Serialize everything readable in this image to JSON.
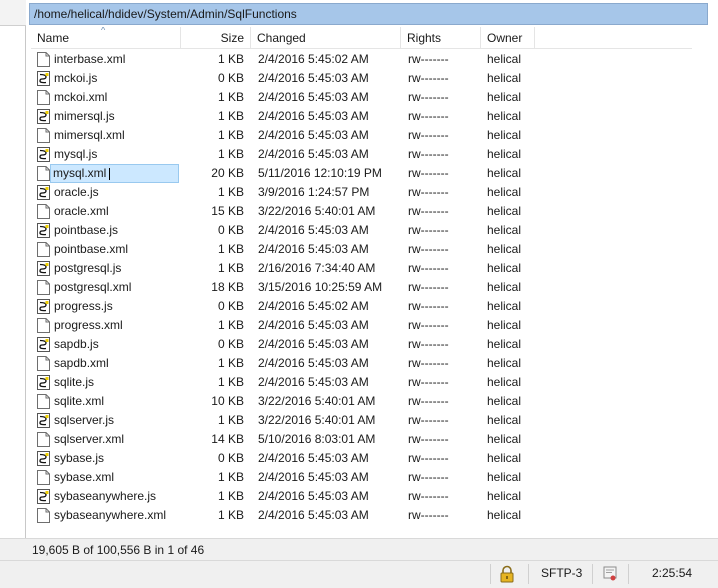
{
  "path": "/home/helical/hdidev/System/Admin/SqlFunctions",
  "columns": {
    "name": "Name",
    "size": "Size",
    "changed": "Changed",
    "rights": "Rights",
    "owner": "Owner"
  },
  "files": [
    {
      "name": "interbase.xml",
      "size": "1 KB",
      "changed": "2/4/2016 5:45:02 AM",
      "rights": "rw-------",
      "owner": "helical",
      "icon": "xml-file-icon"
    },
    {
      "name": "mckoi.js",
      "size": "0 KB",
      "changed": "2/4/2016 5:45:03 AM",
      "rights": "rw-------",
      "owner": "helical",
      "icon": "js-file-icon"
    },
    {
      "name": "mckoi.xml",
      "size": "1 KB",
      "changed": "2/4/2016 5:45:03 AM",
      "rights": "rw-------",
      "owner": "helical",
      "icon": "xml-file-icon"
    },
    {
      "name": "mimersql.js",
      "size": "1 KB",
      "changed": "2/4/2016 5:45:03 AM",
      "rights": "rw-------",
      "owner": "helical",
      "icon": "js-file-icon"
    },
    {
      "name": "mimersql.xml",
      "size": "1 KB",
      "changed": "2/4/2016 5:45:03 AM",
      "rights": "rw-------",
      "owner": "helical",
      "icon": "xml-file-icon"
    },
    {
      "name": "mysql.js",
      "size": "1 KB",
      "changed": "2/4/2016 5:45:03 AM",
      "rights": "rw-------",
      "owner": "helical",
      "icon": "js-file-icon"
    },
    {
      "name": "mysql.xml",
      "size": "20 KB",
      "changed": "5/11/2016 12:10:19 PM",
      "rights": "rw-------",
      "owner": "helical",
      "icon": "xml-file-icon",
      "selected": true
    },
    {
      "name": "oracle.js",
      "size": "1 KB",
      "changed": "3/9/2016 1:24:57 PM",
      "rights": "rw-------",
      "owner": "helical",
      "icon": "js-file-icon"
    },
    {
      "name": "oracle.xml",
      "size": "15 KB",
      "changed": "3/22/2016 5:40:01 AM",
      "rights": "rw-------",
      "owner": "helical",
      "icon": "xml-file-icon"
    },
    {
      "name": "pointbase.js",
      "size": "0 KB",
      "changed": "2/4/2016 5:45:03 AM",
      "rights": "rw-------",
      "owner": "helical",
      "icon": "js-file-icon"
    },
    {
      "name": "pointbase.xml",
      "size": "1 KB",
      "changed": "2/4/2016 5:45:03 AM",
      "rights": "rw-------",
      "owner": "helical",
      "icon": "xml-file-icon"
    },
    {
      "name": "postgresql.js",
      "size": "1 KB",
      "changed": "2/16/2016 7:34:40 AM",
      "rights": "rw-------",
      "owner": "helical",
      "icon": "js-file-icon"
    },
    {
      "name": "postgresql.xml",
      "size": "18 KB",
      "changed": "3/15/2016 10:25:59 AM",
      "rights": "rw-------",
      "owner": "helical",
      "icon": "xml-file-icon"
    },
    {
      "name": "progress.js",
      "size": "0 KB",
      "changed": "2/4/2016 5:45:02 AM",
      "rights": "rw-------",
      "owner": "helical",
      "icon": "js-file-icon"
    },
    {
      "name": "progress.xml",
      "size": "1 KB",
      "changed": "2/4/2016 5:45:03 AM",
      "rights": "rw-------",
      "owner": "helical",
      "icon": "xml-file-icon"
    },
    {
      "name": "sapdb.js",
      "size": "0 KB",
      "changed": "2/4/2016 5:45:03 AM",
      "rights": "rw-------",
      "owner": "helical",
      "icon": "js-file-icon"
    },
    {
      "name": "sapdb.xml",
      "size": "1 KB",
      "changed": "2/4/2016 5:45:03 AM",
      "rights": "rw-------",
      "owner": "helical",
      "icon": "xml-file-icon"
    },
    {
      "name": "sqlite.js",
      "size": "1 KB",
      "changed": "2/4/2016 5:45:03 AM",
      "rights": "rw-------",
      "owner": "helical",
      "icon": "js-file-icon"
    },
    {
      "name": "sqlite.xml",
      "size": "10 KB",
      "changed": "3/22/2016 5:40:01 AM",
      "rights": "rw-------",
      "owner": "helical",
      "icon": "xml-file-icon"
    },
    {
      "name": "sqlserver.js",
      "size": "1 KB",
      "changed": "3/22/2016 5:40:01 AM",
      "rights": "rw-------",
      "owner": "helical",
      "icon": "js-file-icon"
    },
    {
      "name": "sqlserver.xml",
      "size": "14 KB",
      "changed": "5/10/2016 8:03:01 AM",
      "rights": "rw-------",
      "owner": "helical",
      "icon": "xml-file-icon"
    },
    {
      "name": "sybase.js",
      "size": "0 KB",
      "changed": "2/4/2016 5:45:03 AM",
      "rights": "rw-------",
      "owner": "helical",
      "icon": "js-file-icon"
    },
    {
      "name": "sybase.xml",
      "size": "1 KB",
      "changed": "2/4/2016 5:45:03 AM",
      "rights": "rw-------",
      "owner": "helical",
      "icon": "xml-file-icon"
    },
    {
      "name": "sybaseanywhere.js",
      "size": "1 KB",
      "changed": "2/4/2016 5:45:03 AM",
      "rights": "rw-------",
      "owner": "helical",
      "icon": "js-file-icon"
    },
    {
      "name": "sybaseanywhere.xml",
      "size": "1 KB",
      "changed": "2/4/2016 5:45:03 AM",
      "rights": "rw-------",
      "owner": "helical",
      "icon": "xml-file-icon"
    }
  ],
  "status": {
    "selection_info": "19,605 B of 100,556 B in 1 of 46"
  },
  "statusbar": {
    "lock_icon": "lock-icon",
    "protocol": "SFTP-3",
    "cert_icon": "certificate-icon",
    "elapsed": "2:25:54"
  },
  "colors": {
    "path_bar": "#a6c6e9",
    "selection": "#cce8ff",
    "selection_border": "#99c9ef",
    "lock": "#e6b422"
  }
}
